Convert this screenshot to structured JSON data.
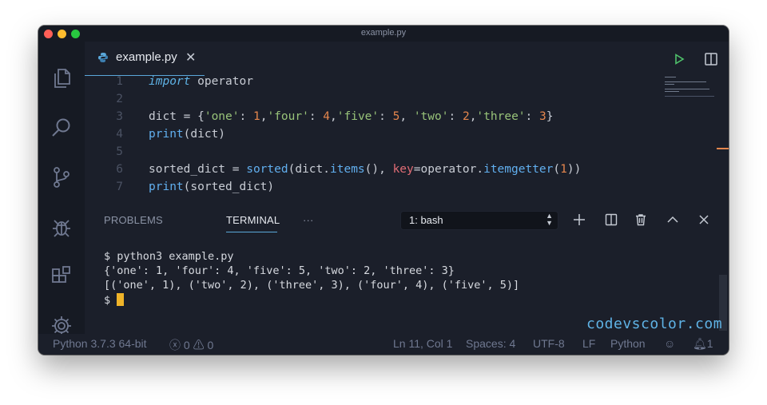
{
  "window": {
    "title": "example.py"
  },
  "tab": {
    "filename": "example.py",
    "close": "✕"
  },
  "editor": {
    "line_numbers": [
      "1",
      "2",
      "3",
      "4",
      "5",
      "6",
      "7"
    ]
  },
  "panel": {
    "tabs": [
      "PROBLEMS",
      "TERMINAL",
      "···"
    ],
    "active_tab": "TERMINAL",
    "terminal_select": "1: bash"
  },
  "terminal": {
    "lines": [
      "$ python3 example.py",
      "{'one': 1, 'four': 4, 'five': 5, 'two': 2, 'three': 3}",
      "[('one', 1), ('two', 2), ('three', 3), ('four', 4), ('five', 5)]",
      "$ "
    ]
  },
  "watermark": "codevscolor.com",
  "statusbar": {
    "python": "Python 3.7.3 64-bit",
    "errors": "0",
    "warnings": "0",
    "position": "Ln 11, Col 1",
    "spaces": "Spaces: 4",
    "encoding": "UTF-8",
    "eol": "LF",
    "language": "Python",
    "notifications": "1"
  },
  "colors": {
    "background": "#1b1f2a",
    "accent": "#5aa7d9",
    "cursor": "#f0b429"
  }
}
